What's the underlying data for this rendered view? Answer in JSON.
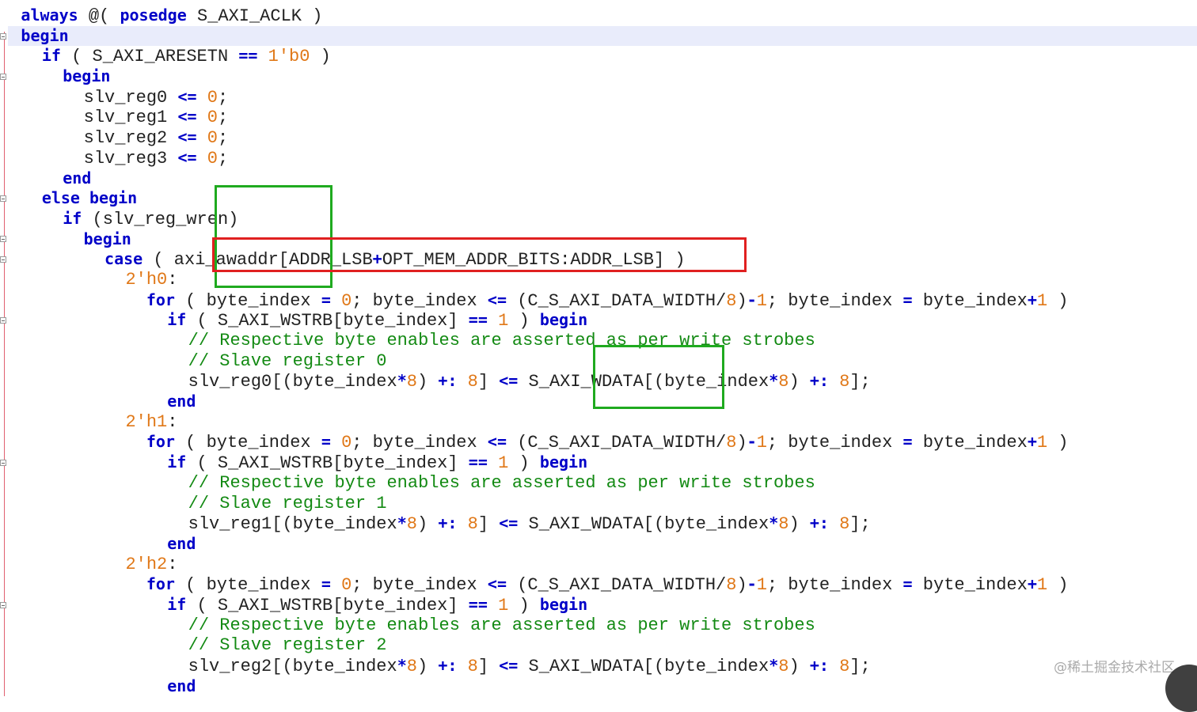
{
  "code_lines": [
    [
      {
        "t": "  "
      },
      {
        "t": "always",
        "c": "kw"
      },
      {
        "t": " @( "
      },
      {
        "t": "posedge",
        "c": "kw"
      },
      {
        "t": " S_AXI_ACLK )"
      }
    ],
    [
      {
        "t": "  "
      },
      {
        "t": "begin",
        "c": "kw"
      }
    ],
    [
      {
        "t": "    "
      },
      {
        "t": "if",
        "c": "kw"
      },
      {
        "t": " ( S_AXI_ARESETN "
      },
      {
        "t": "==",
        "c": "op"
      },
      {
        "t": " "
      },
      {
        "t": "1'b0",
        "c": "num"
      },
      {
        "t": " )"
      }
    ],
    [
      {
        "t": "      "
      },
      {
        "t": "begin",
        "c": "kw"
      }
    ],
    [
      {
        "t": "        slv_reg0 "
      },
      {
        "t": "<=",
        "c": "op"
      },
      {
        "t": " "
      },
      {
        "t": "0",
        "c": "num"
      },
      {
        "t": ";"
      }
    ],
    [
      {
        "t": "        slv_reg1 "
      },
      {
        "t": "<=",
        "c": "op"
      },
      {
        "t": " "
      },
      {
        "t": "0",
        "c": "num"
      },
      {
        "t": ";"
      }
    ],
    [
      {
        "t": "        slv_reg2 "
      },
      {
        "t": "<=",
        "c": "op"
      },
      {
        "t": " "
      },
      {
        "t": "0",
        "c": "num"
      },
      {
        "t": ";"
      }
    ],
    [
      {
        "t": "        slv_reg3 "
      },
      {
        "t": "<=",
        "c": "op"
      },
      {
        "t": " "
      },
      {
        "t": "0",
        "c": "num"
      },
      {
        "t": ";"
      }
    ],
    [
      {
        "t": "      "
      },
      {
        "t": "end",
        "c": "kw"
      }
    ],
    [
      {
        "t": "    "
      },
      {
        "t": "else begin",
        "c": "kw"
      }
    ],
    [
      {
        "t": "      "
      },
      {
        "t": "if",
        "c": "kw"
      },
      {
        "t": " (slv_reg_wren)"
      }
    ],
    [
      {
        "t": "        "
      },
      {
        "t": "begin",
        "c": "kw"
      }
    ],
    [
      {
        "t": "          "
      },
      {
        "t": "case",
        "c": "kw"
      },
      {
        "t": " ( axi_awaddr[ADDR_LSB"
      },
      {
        "t": "+",
        "c": "op"
      },
      {
        "t": "OPT_MEM_ADDR_BITS:ADDR_LSB] )"
      }
    ],
    [
      {
        "t": "            "
      },
      {
        "t": "2'h0",
        "c": "num"
      },
      {
        "t": ":"
      }
    ],
    [
      {
        "t": "              "
      },
      {
        "t": "for",
        "c": "kw"
      },
      {
        "t": " ( byte_index "
      },
      {
        "t": "=",
        "c": "op"
      },
      {
        "t": " "
      },
      {
        "t": "0",
        "c": "num"
      },
      {
        "t": "; byte_index "
      },
      {
        "t": "<=",
        "c": "op"
      },
      {
        "t": " (C_S_AXI_DATA_WIDTH/"
      },
      {
        "t": "8",
        "c": "num"
      },
      {
        "t": ")"
      },
      {
        "t": "-",
        "c": "op"
      },
      {
        "t": "1",
        "c": "num"
      },
      {
        "t": "; byte_index "
      },
      {
        "t": "=",
        "c": "op"
      },
      {
        "t": " byte_index"
      },
      {
        "t": "+",
        "c": "op"
      },
      {
        "t": "1",
        "c": "num"
      },
      {
        "t": " )"
      }
    ],
    [
      {
        "t": "                "
      },
      {
        "t": "if",
        "c": "kw"
      },
      {
        "t": " ( S_AXI_WSTRB[byte_index] "
      },
      {
        "t": "==",
        "c": "op"
      },
      {
        "t": " "
      },
      {
        "t": "1",
        "c": "num"
      },
      {
        "t": " ) "
      },
      {
        "t": "begin",
        "c": "kw"
      }
    ],
    [
      {
        "t": "                  "
      },
      {
        "t": "// Respective byte enables are asserted as per write strobes",
        "c": "cm"
      }
    ],
    [
      {
        "t": "                  "
      },
      {
        "t": "// Slave register 0",
        "c": "cm"
      }
    ],
    [
      {
        "t": "                  slv_reg0[(byte_index"
      },
      {
        "t": "*",
        "c": "op"
      },
      {
        "t": "8",
        "c": "num"
      },
      {
        "t": ") "
      },
      {
        "t": "+:",
        "c": "op"
      },
      {
        "t": " "
      },
      {
        "t": "8",
        "c": "num"
      },
      {
        "t": "] "
      },
      {
        "t": "<=",
        "c": "op"
      },
      {
        "t": " S_AXI_WDATA[(byte_index"
      },
      {
        "t": "*",
        "c": "op"
      },
      {
        "t": "8",
        "c": "num"
      },
      {
        "t": ") "
      },
      {
        "t": "+:",
        "c": "op"
      },
      {
        "t": " "
      },
      {
        "t": "8",
        "c": "num"
      },
      {
        "t": "];"
      }
    ],
    [
      {
        "t": "                "
      },
      {
        "t": "end",
        "c": "kw"
      }
    ],
    [
      {
        "t": "            "
      },
      {
        "t": "2'h1",
        "c": "num"
      },
      {
        "t": ":"
      }
    ],
    [
      {
        "t": "              "
      },
      {
        "t": "for",
        "c": "kw"
      },
      {
        "t": " ( byte_index "
      },
      {
        "t": "=",
        "c": "op"
      },
      {
        "t": " "
      },
      {
        "t": "0",
        "c": "num"
      },
      {
        "t": "; byte_index "
      },
      {
        "t": "<=",
        "c": "op"
      },
      {
        "t": " (C_S_AXI_DATA_WIDTH/"
      },
      {
        "t": "8",
        "c": "num"
      },
      {
        "t": ")"
      },
      {
        "t": "-",
        "c": "op"
      },
      {
        "t": "1",
        "c": "num"
      },
      {
        "t": "; byte_index "
      },
      {
        "t": "=",
        "c": "op"
      },
      {
        "t": " byte_index"
      },
      {
        "t": "+",
        "c": "op"
      },
      {
        "t": "1",
        "c": "num"
      },
      {
        "t": " )"
      }
    ],
    [
      {
        "t": "                "
      },
      {
        "t": "if",
        "c": "kw"
      },
      {
        "t": " ( S_AXI_WSTRB[byte_index] "
      },
      {
        "t": "==",
        "c": "op"
      },
      {
        "t": " "
      },
      {
        "t": "1",
        "c": "num"
      },
      {
        "t": " ) "
      },
      {
        "t": "begin",
        "c": "kw"
      }
    ],
    [
      {
        "t": "                  "
      },
      {
        "t": "// Respective byte enables are asserted as per write strobes",
        "c": "cm"
      }
    ],
    [
      {
        "t": "                  "
      },
      {
        "t": "// Slave register 1",
        "c": "cm"
      }
    ],
    [
      {
        "t": "                  slv_reg1[(byte_index"
      },
      {
        "t": "*",
        "c": "op"
      },
      {
        "t": "8",
        "c": "num"
      },
      {
        "t": ") "
      },
      {
        "t": "+:",
        "c": "op"
      },
      {
        "t": " "
      },
      {
        "t": "8",
        "c": "num"
      },
      {
        "t": "] "
      },
      {
        "t": "<=",
        "c": "op"
      },
      {
        "t": " S_AXI_WDATA[(byte_index"
      },
      {
        "t": "*",
        "c": "op"
      },
      {
        "t": "8",
        "c": "num"
      },
      {
        "t": ") "
      },
      {
        "t": "+:",
        "c": "op"
      },
      {
        "t": " "
      },
      {
        "t": "8",
        "c": "num"
      },
      {
        "t": "];"
      }
    ],
    [
      {
        "t": "                "
      },
      {
        "t": "end",
        "c": "kw"
      }
    ],
    [
      {
        "t": "            "
      },
      {
        "t": "2'h2",
        "c": "num"
      },
      {
        "t": ":"
      }
    ],
    [
      {
        "t": "              "
      },
      {
        "t": "for",
        "c": "kw"
      },
      {
        "t": " ( byte_index "
      },
      {
        "t": "=",
        "c": "op"
      },
      {
        "t": " "
      },
      {
        "t": "0",
        "c": "num"
      },
      {
        "t": "; byte_index "
      },
      {
        "t": "<=",
        "c": "op"
      },
      {
        "t": " (C_S_AXI_DATA_WIDTH/"
      },
      {
        "t": "8",
        "c": "num"
      },
      {
        "t": ")"
      },
      {
        "t": "-",
        "c": "op"
      },
      {
        "t": "1",
        "c": "num"
      },
      {
        "t": "; byte_index "
      },
      {
        "t": "=",
        "c": "op"
      },
      {
        "t": " byte_index"
      },
      {
        "t": "+",
        "c": "op"
      },
      {
        "t": "1",
        "c": "num"
      },
      {
        "t": " )"
      }
    ],
    [
      {
        "t": "                "
      },
      {
        "t": "if",
        "c": "kw"
      },
      {
        "t": " ( S_AXI_WSTRB[byte_index] "
      },
      {
        "t": "==",
        "c": "op"
      },
      {
        "t": " "
      },
      {
        "t": "1",
        "c": "num"
      },
      {
        "t": " ) "
      },
      {
        "t": "begin",
        "c": "kw"
      }
    ],
    [
      {
        "t": "                  "
      },
      {
        "t": "// Respective byte enables are asserted as per write strobes",
        "c": "cm"
      }
    ],
    [
      {
        "t": "                  "
      },
      {
        "t": "// Slave register 2",
        "c": "cm"
      }
    ],
    [
      {
        "t": "                  slv_reg2[(byte_index"
      },
      {
        "t": "*",
        "c": "op"
      },
      {
        "t": "8",
        "c": "num"
      },
      {
        "t": ") "
      },
      {
        "t": "+:",
        "c": "op"
      },
      {
        "t": " "
      },
      {
        "t": "8",
        "c": "num"
      },
      {
        "t": "] "
      },
      {
        "t": "<=",
        "c": "op"
      },
      {
        "t": " S_AXI_WDATA[(byte_index"
      },
      {
        "t": "*",
        "c": "op"
      },
      {
        "t": "8",
        "c": "num"
      },
      {
        "t": ") "
      },
      {
        "t": "+:",
        "c": "op"
      },
      {
        "t": " "
      },
      {
        "t": "8",
        "c": "num"
      },
      {
        "t": "];"
      }
    ],
    [
      {
        "t": "                "
      },
      {
        "t": "end",
        "c": "kw"
      }
    ]
  ],
  "colors": {
    "keyword": "#0000c8",
    "number": "#e07818",
    "comment": "#138a13",
    "current_line": "#e9ecfb",
    "annotation_green": "#1faa1f",
    "annotation_red": "#e02020"
  },
  "watermark": "@稀土掘金技术社区"
}
